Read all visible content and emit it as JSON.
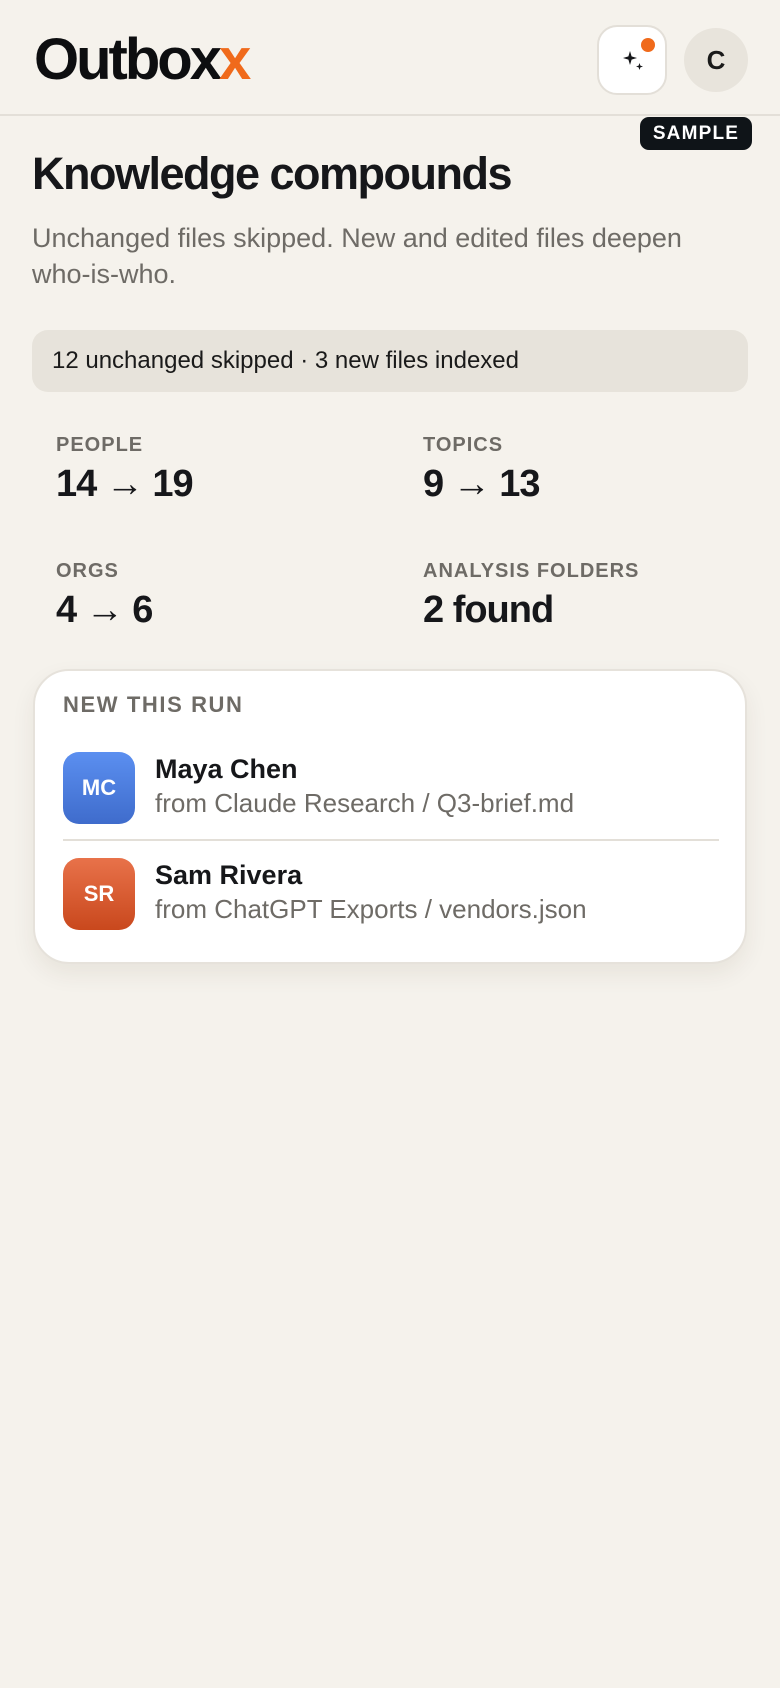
{
  "app": {
    "logo_main": "Outbox",
    "logo_accent": "x",
    "user_initial": "C",
    "badge": "SAMPLE"
  },
  "page": {
    "title": "Knowledge compounds",
    "subtitle": "Unchanged files skipped. New and edited files deepen who-is-who.",
    "banner": "12 unchanged skipped · 3 new files indexed"
  },
  "stats": [
    {
      "label": "PEOPLE",
      "value": "14 → 19"
    },
    {
      "label": "TOPICS",
      "value": "9 → 13"
    },
    {
      "label": "ORGS",
      "value": "4 → 6"
    },
    {
      "label": "ANALYSIS FOLDERS",
      "value": "2 found"
    }
  ],
  "new_this_run": {
    "title": "NEW THIS RUN",
    "people": [
      {
        "initials": "MC",
        "name": "Maya Chen",
        "source": "from Claude Research / Q3-brief.md",
        "color": "#4f7fdc"
      },
      {
        "initials": "SR",
        "name": "Sam Rivera",
        "source": "from ChatGPT Exports / vendors.json",
        "color": "#d9582a"
      }
    ]
  },
  "colors": {
    "accent": "#f06a1b",
    "background": "#f5f2ec",
    "badge_bg": "#0f1418"
  },
  "icons": {
    "assistant": "sparkles-icon",
    "notification": "notification-dot"
  }
}
